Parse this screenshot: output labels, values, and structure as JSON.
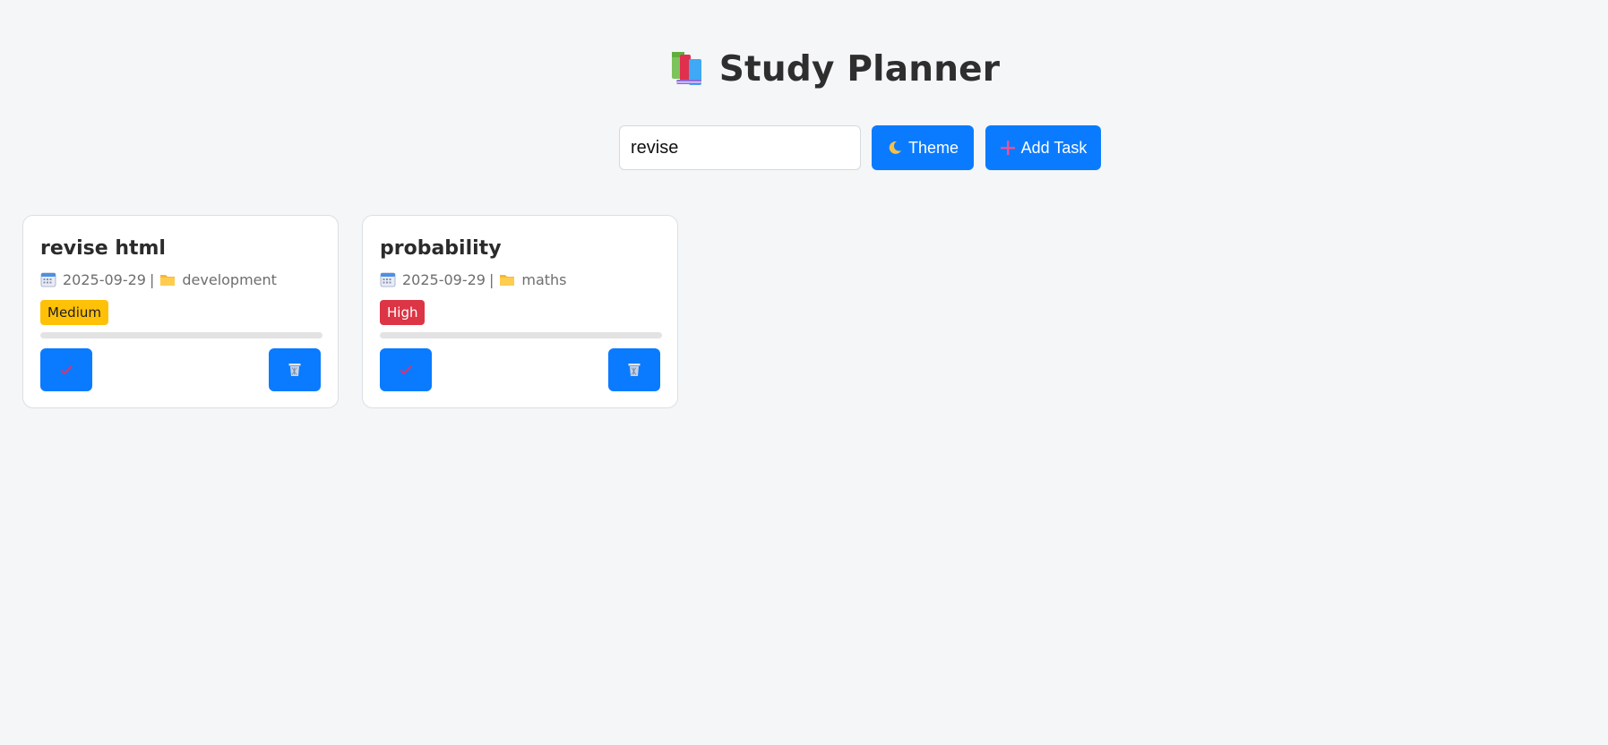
{
  "header": {
    "title": "Study Planner",
    "icon": "books-icon"
  },
  "toolbar": {
    "search_value": "revise",
    "theme_label": "Theme",
    "theme_icon": "moon-icon",
    "add_label": "Add Task",
    "add_icon": "plus-icon"
  },
  "tasks": [
    {
      "title": "revise html",
      "date": "2025-09-29",
      "separator": "|",
      "category": "development",
      "priority": "Medium",
      "progress": 0
    },
    {
      "title": "probability",
      "date": "2025-09-29",
      "separator": "|",
      "category": "maths",
      "priority": "High",
      "progress": 0
    }
  ],
  "colors": {
    "accent": "#0a7bff",
    "background": "#f4f6f8",
    "medium_badge": "#ffc107",
    "high_badge": "#dc3545"
  }
}
